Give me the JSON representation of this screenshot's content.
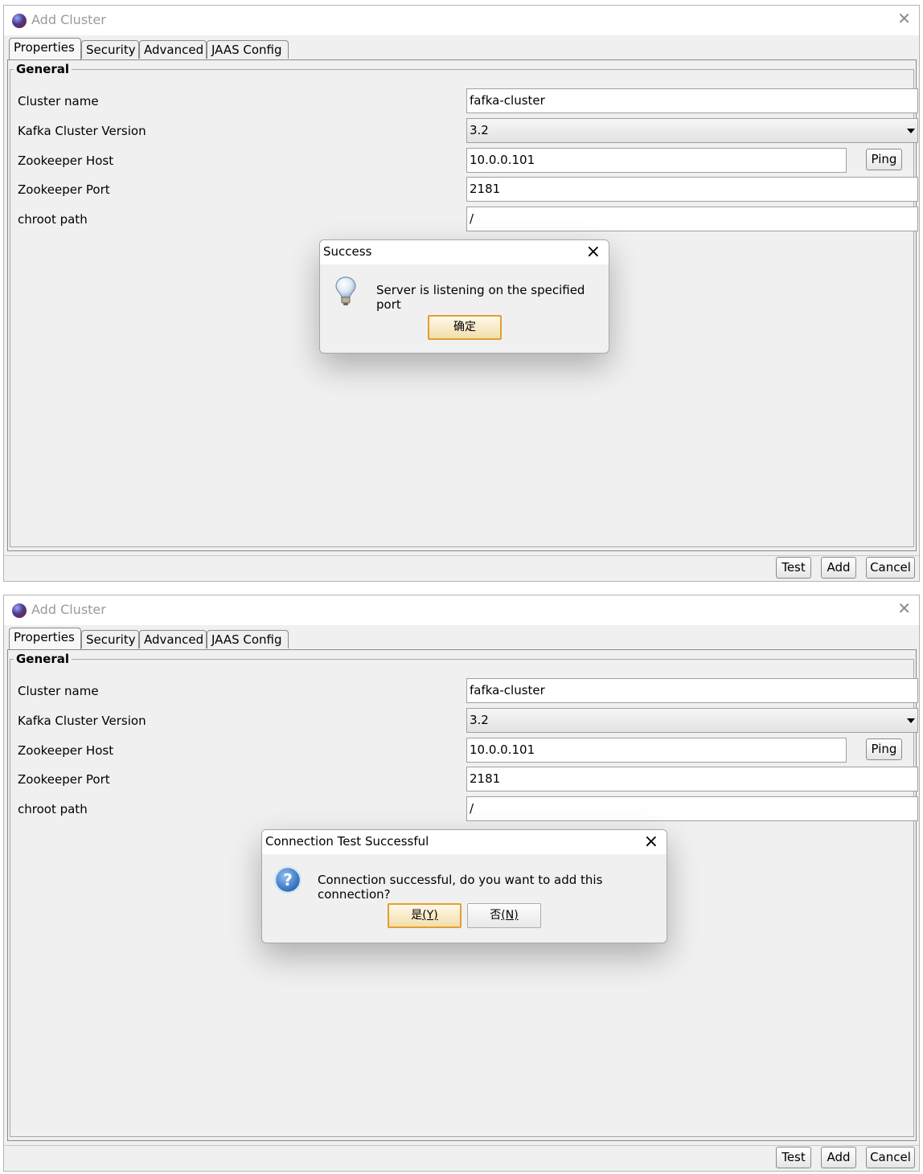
{
  "windows": [
    {
      "title": "Add Cluster",
      "tabs": [
        "Properties",
        "Security",
        "Advanced",
        "JAAS Config"
      ],
      "group_title": "General",
      "fields": {
        "cluster_name_label": "Cluster name",
        "cluster_name_value": "fafka-cluster",
        "version_label": "Kafka Cluster Version",
        "version_value": "3.2",
        "zk_host_label": "Zookeeper Host",
        "zk_host_value": "10.0.0.101",
        "zk_port_label": "Zookeeper Port",
        "zk_port_value": "2181",
        "chroot_label": "chroot path",
        "chroot_value": "/"
      },
      "ping_label": "Ping",
      "footer": {
        "test": "Test",
        "add": "Add",
        "cancel": "Cancel"
      },
      "dialog": {
        "title": "Success",
        "icon": "lightbulb-icon",
        "message": "Server is listening on the specified port",
        "ok_label": "确定"
      }
    },
    {
      "title": "Add Cluster",
      "tabs": [
        "Properties",
        "Security",
        "Advanced",
        "JAAS Config"
      ],
      "group_title": "General",
      "fields": {
        "cluster_name_label": "Cluster name",
        "cluster_name_value": "fafka-cluster",
        "version_label": "Kafka Cluster Version",
        "version_value": "3.2",
        "zk_host_label": "Zookeeper Host",
        "zk_host_value": "10.0.0.101",
        "zk_port_label": "Zookeeper Port",
        "zk_port_value": "2181",
        "chroot_label": "chroot path",
        "chroot_value": "/"
      },
      "ping_label": "Ping",
      "footer": {
        "test": "Test",
        "add": "Add",
        "cancel": "Cancel"
      },
      "dialog": {
        "title": "Connection Test Successful",
        "icon": "question-icon",
        "message": "Connection successful, do you want to add this connection?",
        "yes_label": "是",
        "yes_mnemonic": "(Y)",
        "no_label": "否",
        "no_mnemonic": "(N)"
      }
    }
  ]
}
